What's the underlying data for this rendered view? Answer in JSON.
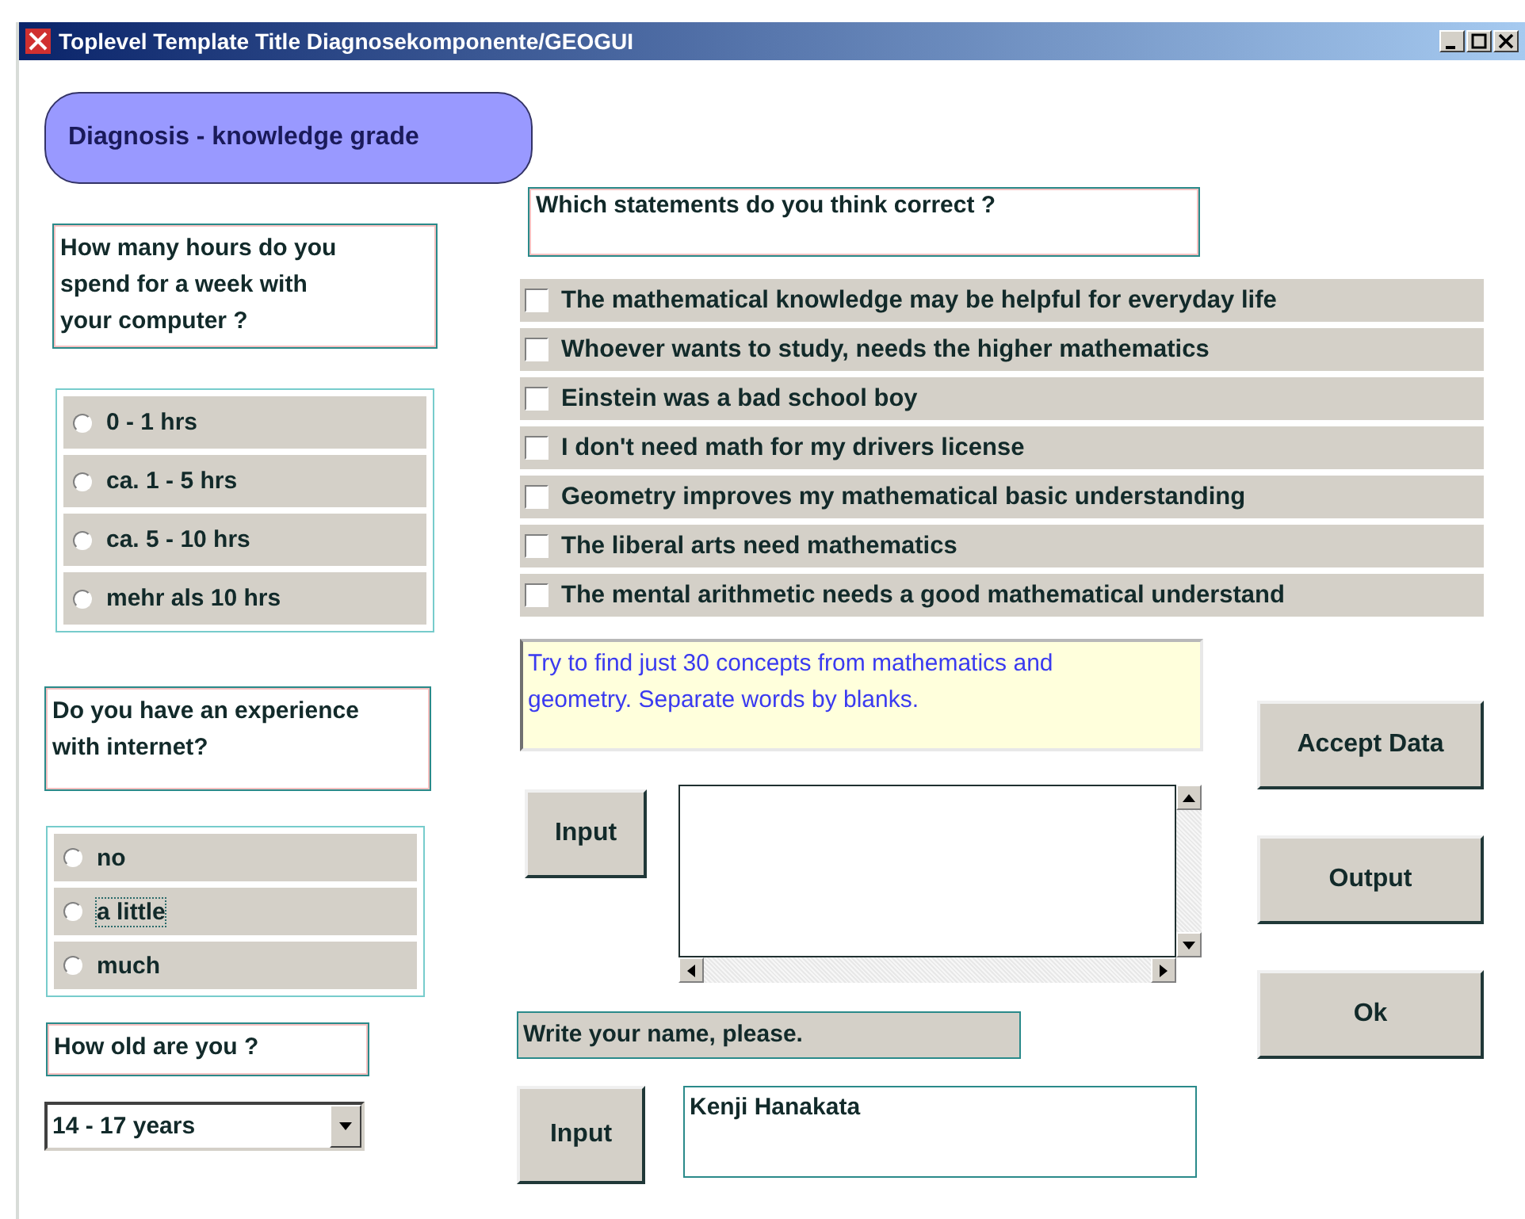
{
  "window": {
    "title": "Toplevel Template Title Diagnosekomponente/GEOGUI"
  },
  "heading": "Diagnosis - knowledge grade",
  "hours": {
    "question": "How many hours do you spend for a week with your computer ?",
    "options": [
      {
        "label": "0 - 1 hrs",
        "selected": false,
        "focused": false
      },
      {
        "label": "ca. 1 - 5 hrs",
        "selected": false,
        "focused": false
      },
      {
        "label": "ca. 5 - 10 hrs",
        "selected": false,
        "focused": false
      },
      {
        "label": "mehr als 10 hrs",
        "selected": false,
        "focused": false
      }
    ]
  },
  "internet": {
    "question": "Do you have an experience with internet?",
    "options": [
      {
        "label": "no",
        "selected": false,
        "focused": false
      },
      {
        "label": "a little",
        "selected": false,
        "focused": true
      },
      {
        "label": "much",
        "selected": false,
        "focused": false
      }
    ]
  },
  "age": {
    "question": "How old are you ?",
    "value": "14 - 17 years"
  },
  "statements": {
    "question": "Which statements do you think correct ?",
    "items": [
      {
        "label": "The mathematical knowledge may be helpful for everyday life",
        "checked": false
      },
      {
        "label": "Whoever wants to study, needs the higher mathematics",
        "checked": false
      },
      {
        "label": "Einstein was a bad school boy",
        "checked": false
      },
      {
        "label": "I don't need math for my drivers license",
        "checked": false
      },
      {
        "label": "Geometry improves my mathematical basic understanding",
        "checked": false
      },
      {
        "label": "The liberal arts need mathematics",
        "checked": false
      },
      {
        "label": "The mental arithmetic needs a good mathematical understand",
        "checked": false
      }
    ]
  },
  "concepts": {
    "hint": "Try to find just 30 concepts from mathematics and geometry. Separate words by blanks.",
    "button": "Input"
  },
  "name": {
    "label": "Write your name, please.",
    "button": "Input",
    "value": "Kenji Hanakata"
  },
  "actions": [
    "Accept Data",
    "Output",
    "Ok"
  ]
}
